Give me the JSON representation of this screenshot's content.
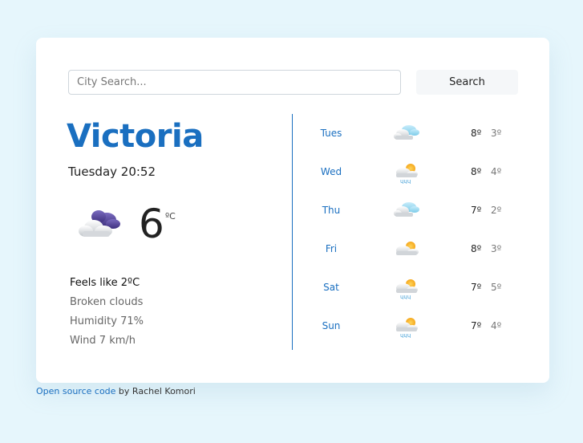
{
  "search": {
    "placeholder": "City Search...",
    "button_label": "Search"
  },
  "current": {
    "city": "Victoria",
    "datetime": "Tuesday 20:52",
    "icon": "cloud-icon",
    "temperature": "6",
    "unit": "ºC",
    "feels_like": "Feels like 2ºC",
    "description": "Broken clouds",
    "humidity": "Humidity 71%",
    "wind": "Wind 7 km/h"
  },
  "forecast": [
    {
      "day": "Tues",
      "icon": "cloudy-icon",
      "high": "8º",
      "low": "3º"
    },
    {
      "day": "Wed",
      "icon": "rain-sun-icon",
      "high": "8º",
      "low": "4º"
    },
    {
      "day": "Thu",
      "icon": "cloudy-icon",
      "high": "7º",
      "low": "2º"
    },
    {
      "day": "Fri",
      "icon": "partly-cloudy-icon",
      "high": "8º",
      "low": "3º"
    },
    {
      "day": "Sat",
      "icon": "rain-sun-icon",
      "high": "7º",
      "low": "5º"
    },
    {
      "day": "Sun",
      "icon": "rain-sun-icon",
      "high": "7º",
      "low": "4º"
    }
  ],
  "footer": {
    "link_text": "Open source code",
    "author_text": " by Rachel Komori"
  },
  "colors": {
    "accent": "#1a6fc0",
    "background": "#e6f6fc"
  }
}
